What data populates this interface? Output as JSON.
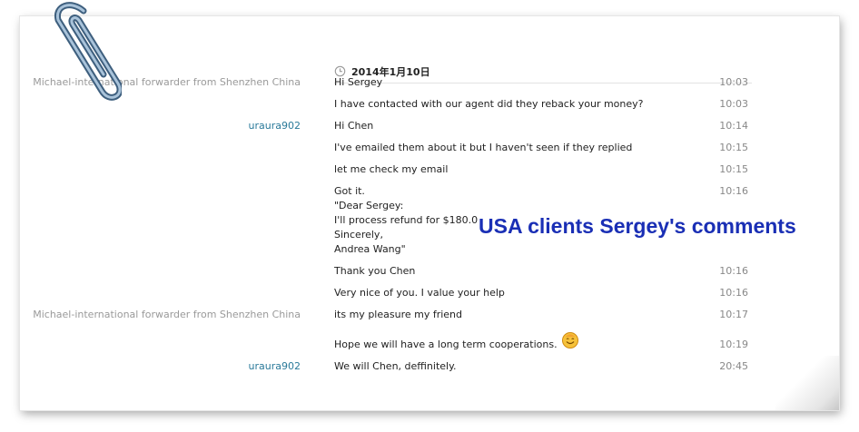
{
  "chat": {
    "date": "2014年1月10日",
    "messages": [
      {
        "sender": "Michael-international forwarder from Shenzhen China",
        "text": "Hi Sergey",
        "time": "10:03"
      },
      {
        "sender": "",
        "text": "I have contacted with our agent did they reback your money?",
        "time": "10:03"
      },
      {
        "sender": "uraura902",
        "text": "Hi Chen",
        "time": "10:14"
      },
      {
        "sender": "",
        "text": "I've emailed them about it but I haven't seen if they replied",
        "time": "10:15"
      },
      {
        "sender": "",
        "text": "let me check my email",
        "time": "10:15"
      },
      {
        "sender": "",
        "text": "Got it.\n\"Dear Sergey:\nI'll process refund for $180.0\nSincerely,\nAndrea Wang\"",
        "time": "10:16"
      },
      {
        "sender": "",
        "text": "Thank you Chen",
        "time": "10:16"
      },
      {
        "sender": "",
        "text": "Very nice of you. I value your help",
        "time": "10:16"
      },
      {
        "sender": "Michael-international forwarder from Shenzhen China",
        "text": "its my pleasure my friend",
        "time": "10:17"
      },
      {
        "sender": "",
        "text": "Hope we will have a long term cooperations.",
        "time": "10:19",
        "emoji": "smiley-emoji"
      },
      {
        "sender": "uraura902",
        "text": "We will Chen, deffinitely.",
        "time": "20:45"
      }
    ]
  },
  "overlay": {
    "caption": "USA clients Sergey's comments"
  },
  "icons": {
    "clock": "clock-icon",
    "paperclip": "paperclip-icon",
    "smiley": "smiley-emoji"
  },
  "colors": {
    "overlay_text": "#1a2fb5",
    "uraura_sender": "#2a7a9a",
    "michael_sender": "#9a9a9a"
  }
}
